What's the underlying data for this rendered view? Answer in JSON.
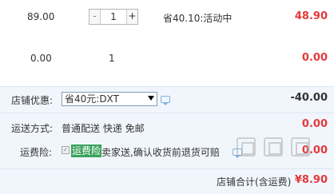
{
  "item1": {
    "price": "89.00",
    "qty_minus": "-",
    "qty": "1",
    "qty_plus": "+",
    "promo": "省40.10:活动中",
    "subtotal": "48.90"
  },
  "item2": {
    "price": "0.00",
    "qty": "1",
    "subtotal": "0.00"
  },
  "discount": {
    "label": "店铺优惠:",
    "selected": "省40元:DXT",
    "amount": "-40.00"
  },
  "shipping": {
    "label": "运送方式:",
    "value": "普通配送 快递 免邮",
    "amount": "0.00"
  },
  "insurance": {
    "label": "运费险:",
    "checkmark": "✓",
    "tag": "运费险",
    "desc": "卖家送,确认收货前退货可赔",
    "amount": "0.00"
  },
  "total": {
    "label": "店铺合计(含运费)",
    "amount": "¥8.90"
  },
  "colors": {
    "price_red": "#e4393c",
    "panel_bg": "#f1f6fc",
    "ins_tag_bg": "#39a35b"
  }
}
